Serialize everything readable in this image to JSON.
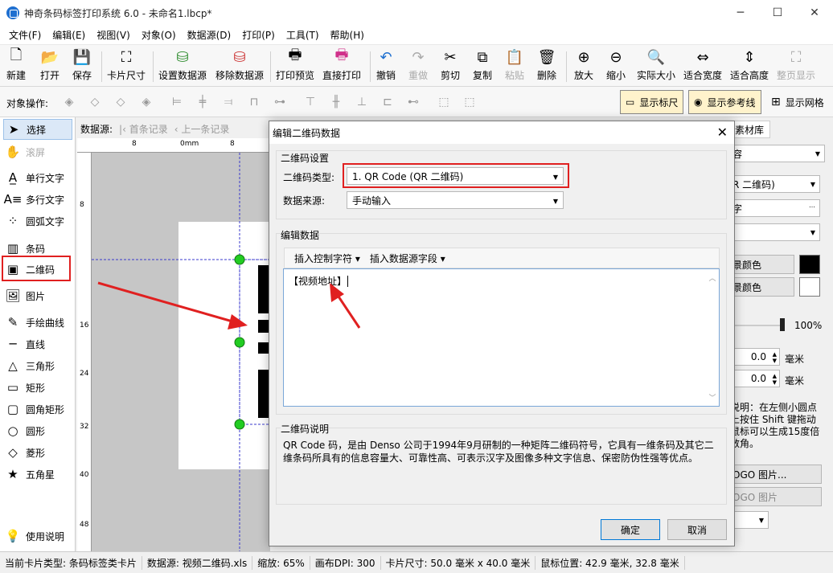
{
  "window": {
    "title": "神奇条码标签打印系统 6.0 - 未命名1.lbcp*"
  },
  "menu": [
    "文件(F)",
    "编辑(E)",
    "视图(V)",
    "对象(O)",
    "数据源(D)",
    "打印(P)",
    "工具(T)",
    "帮助(H)"
  ],
  "toolbar": {
    "new": "新建",
    "open": "打开",
    "save": "保存",
    "card_size": "卡片尺寸",
    "set_datasource": "设置数据源",
    "remove_datasource": "移除数据源",
    "print_preview": "打印预览",
    "direct_print": "直接打印",
    "undo": "撤销",
    "redo": "重做",
    "cut": "剪切",
    "copy": "复制",
    "paste": "粘贴",
    "delete": "删除",
    "zoom_in": "放大",
    "zoom_out": "缩小",
    "actual_size": "实际大小",
    "fit_width": "适合宽度",
    "fit_height": "适合高度",
    "full_page": "整页显示"
  },
  "objbar": {
    "label": "对象操作:",
    "show_ruler": "显示标尺",
    "show_guides": "显示参考线",
    "show_grid": "显示网格"
  },
  "tools": {
    "select": "选择",
    "scroll": "滚屏",
    "single_text": "单行文字",
    "multi_text": "多行文字",
    "arc_text": "圆弧文字",
    "barcode": "条码",
    "qrcode": "二维码",
    "image": "图片",
    "freehand": "手绘曲线",
    "line": "直线",
    "triangle": "三角形",
    "rect": "矩形",
    "round_rect": "圆角矩形",
    "circle": "圆形",
    "diamond": "菱形",
    "star": "五角星",
    "help": "使用说明"
  },
  "records": {
    "label": "数据源:",
    "first": "首条记录",
    "prev": "上一条记录"
  },
  "ruler": {
    "h": [
      "8",
      "0mm",
      "8"
    ],
    "v": [
      "8",
      "16",
      "24",
      "32",
      "40",
      "48"
    ]
  },
  "right_panel": {
    "tab": "素材库",
    "content_dd": "容",
    "qr_type_dd": "R 二维码)",
    "source_field": "字",
    "fg_color_btn": "景颜色",
    "bg_color_btn": "景颜色",
    "opacity": "100%",
    "x_value": "0.0",
    "y_value": "0.0",
    "unit": "毫米",
    "hint": "说明：在左侧小圆点上按住 Shift 键拖动鼠标可以生成15度倍数角。",
    "logo_btn1": "OGO 图片...",
    "logo_btn2": "OGO 图片"
  },
  "dialog": {
    "title": "编辑二维码数据",
    "group_settings": "二维码设置",
    "type_label": "二维码类型:",
    "type_value": "1. QR Code (QR 二维码)",
    "source_label": "数据来源:",
    "source_value": "手动输入",
    "group_edit": "编辑数据",
    "insert_ctrl": "插入控制字符",
    "insert_field": "插入数据源字段",
    "edit_content": "【视频地址】",
    "group_desc": "二维码说明",
    "desc_text": "QR Code 码，是由 Denso 公司于1994年9月研制的一种矩阵二维码符号，它具有一维条码及其它二维条码所具有的信息容量大、可靠性高、可表示汉字及图像多种文字信息、保密防伪性强等优点。",
    "ok": "确定",
    "cancel": "取消"
  },
  "status": {
    "card_type": "当前卡片类型: 条码标签类卡片",
    "datasource": "数据源: 视频二维码.xls",
    "zoom": "缩放: 65%",
    "dpi": "画布DPI: 300",
    "card_size": "卡片尺寸: 50.0 毫米 x 40.0 毫米",
    "mouse": "鼠标位置: 42.9 毫米, 32.8 毫米"
  },
  "colors": {
    "accent": "#1e6fd0",
    "highlight": "#e02020",
    "selected_tool": "#dbe8f7"
  }
}
